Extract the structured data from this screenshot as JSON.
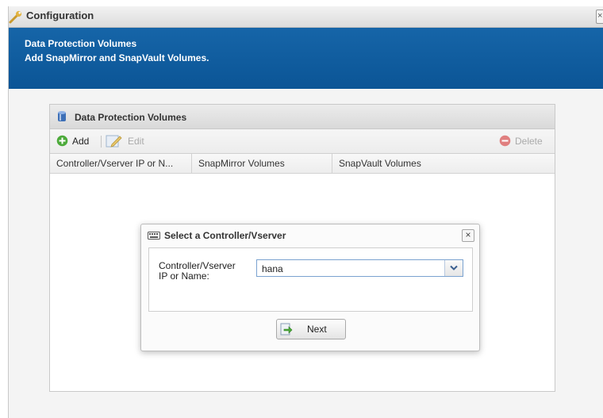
{
  "window": {
    "title": "Configuration",
    "close_glyph": "×"
  },
  "banner": {
    "title": "Data Protection Volumes",
    "subtitle": "Add SnapMirror and SnapVault Volumes."
  },
  "panel": {
    "title": "Data Protection Volumes",
    "toolbar": {
      "add_label": "Add",
      "edit_label": "Edit",
      "delete_label": "Delete"
    },
    "columns": [
      "Controller/Vserver IP or N...",
      "SnapMirror Volumes",
      "SnapVault Volumes"
    ],
    "rows": []
  },
  "dialog": {
    "title": "Select a Controller/Vserver",
    "close_glyph": "×",
    "field_label": "Controller/Vserver IP or Name:",
    "field_value": "hana",
    "next_label": "Next"
  },
  "icons": {
    "title": "wrench-icon",
    "panel": "database-icon",
    "add": "add-circle-icon",
    "edit": "edit-icon",
    "delete": "delete-circle-icon",
    "dialog": "keyboard-icon",
    "next": "next-arrow-icon"
  },
  "colors": {
    "banner": "#0b5596",
    "add_icon": "#4caa3a",
    "delete_icon": "#e07f7f"
  }
}
